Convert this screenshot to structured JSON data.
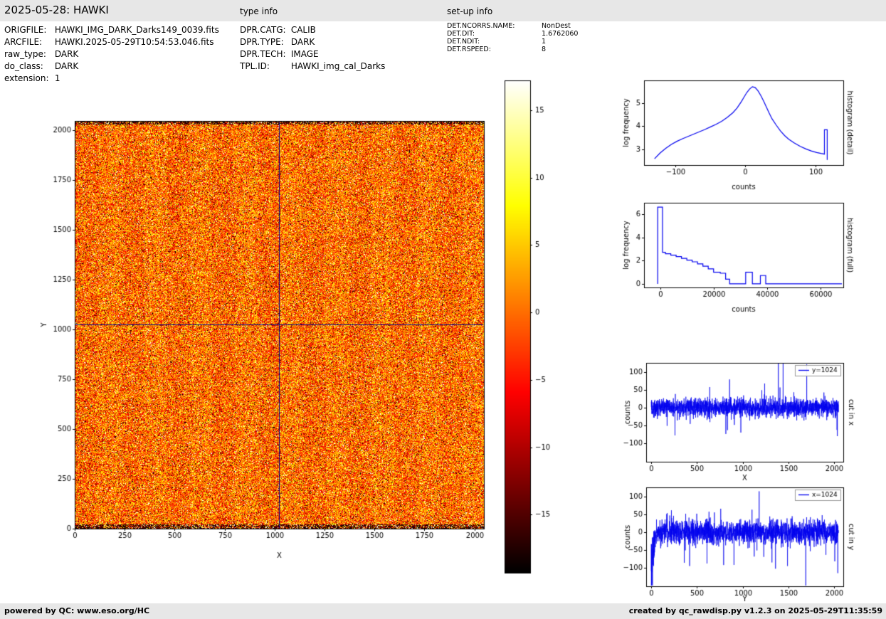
{
  "header": {
    "title": "2025-05-28: HAWKI",
    "type_info_label": "type info",
    "setup_info_label": "set-up info"
  },
  "file_info": {
    "rows": [
      {
        "label": "ORIGFILE:",
        "value": "HAWKI_IMG_DARK_Darks149_0039.fits"
      },
      {
        "label": "ARCFILE:",
        "value": "HAWKI.2025-05-29T10:54:53.046.fits"
      },
      {
        "label": "raw_type:",
        "value": "DARK"
      },
      {
        "label": "do_class:",
        "value": "DARK"
      },
      {
        "label": "extension:",
        "value": "1"
      }
    ]
  },
  "type_info": {
    "rows": [
      {
        "label": "DPR.CATG:",
        "value": "CALIB"
      },
      {
        "label": "DPR.TYPE:",
        "value": "DARK"
      },
      {
        "label": "DPR.TECH:",
        "value": "IMAGE"
      },
      {
        "label": "TPL.ID:",
        "value": "HAWKI_img_cal_Darks"
      }
    ]
  },
  "setup_info": {
    "rows": [
      {
        "label": "DET.NCORRS.NAME:",
        "value": "NonDest"
      },
      {
        "label": "DET.DIT:",
        "value": "1.6762060"
      },
      {
        "label": "DET.NDIT:",
        "value": "1"
      },
      {
        "label": "DET.RSPEED:",
        "value": "8"
      }
    ]
  },
  "footer": {
    "left": "powered by QC: www.eso.org/HC",
    "right": "created by qc_rawdisp.py v1.2.3 on 2025-05-29T11:35:59"
  },
  "colors": {
    "line_blue": "#0000ee",
    "crosshair_navy": "#00008b",
    "panel_gray": "#e7e7e7"
  },
  "chart_data": [
    {
      "id": "main-image",
      "type": "heatmap",
      "xlabel": "X",
      "ylabel": "Y",
      "xlim": [
        0,
        2048
      ],
      "ylim": [
        0,
        2048
      ],
      "xticks": [
        0,
        250,
        500,
        750,
        1000,
        1250,
        1500,
        1750,
        2000
      ],
      "yticks": [
        0,
        250,
        500,
        750,
        1000,
        1250,
        1500,
        1750,
        2000
      ],
      "colormap": "hot",
      "value_range": [
        -19.3,
        17.2
      ],
      "colorbar_ticks": [
        15,
        10,
        5,
        0,
        -5,
        -10,
        -15
      ],
      "crosshair_x": 1024,
      "crosshair_y": 1024,
      "description": "raw HAWKI dark frame: random noise centered on 0 counts with hot/cold pixel speckle, darker rows along top and bottom edges, navy crosshair lines at x=1024 and y=1024"
    },
    {
      "id": "histogram-detail",
      "type": "line",
      "side_label": "histogram (detail)",
      "xlabel": "counts",
      "ylabel": "log frequency",
      "xlim": [
        -145,
        140
      ],
      "ylim": [
        2.33,
        5.97
      ],
      "xticks": [
        -100,
        0,
        100
      ],
      "yticks": [
        3,
        4,
        5
      ],
      "x": [
        -130,
        -122,
        -114,
        -106,
        -98,
        -90,
        -82,
        -74,
        -66,
        -58,
        -50,
        -42,
        -34,
        -26,
        -18,
        -12,
        -6,
        -2,
        2,
        6,
        10,
        14,
        18,
        22,
        26,
        30,
        34,
        38,
        44,
        50,
        56,
        62,
        70,
        78,
        86,
        94,
        102,
        108,
        112,
        113,
        113,
        117,
        117
      ],
      "y": [
        2.6,
        2.85,
        3.05,
        3.22,
        3.35,
        3.46,
        3.56,
        3.66,
        3.76,
        3.86,
        3.97,
        4.08,
        4.21,
        4.38,
        4.58,
        4.78,
        5.05,
        5.25,
        5.45,
        5.6,
        5.7,
        5.66,
        5.52,
        5.32,
        5.08,
        4.82,
        4.56,
        4.32,
        4.05,
        3.8,
        3.6,
        3.44,
        3.28,
        3.14,
        3.03,
        2.94,
        2.87,
        2.83,
        2.81,
        2.8,
        3.85,
        3.85,
        2.55
      ]
    },
    {
      "id": "histogram-full",
      "type": "step",
      "side_label": "histogram (full)",
      "xlabel": "counts",
      "ylabel": "log frequency",
      "xlim": [
        -6000,
        68500
      ],
      "ylim": [
        -0.31,
        7.0
      ],
      "xticks": [
        0,
        20000,
        40000,
        60000
      ],
      "yticks": [
        0,
        2,
        4,
        6
      ],
      "bins": [
        [
          -900,
          900,
          6.62
        ],
        [
          900,
          2000,
          2.72
        ],
        [
          2000,
          4000,
          2.6
        ],
        [
          4000,
          6000,
          2.48
        ],
        [
          6000,
          8000,
          2.35
        ],
        [
          8000,
          10000,
          2.2
        ],
        [
          10000,
          12000,
          2.05
        ],
        [
          12000,
          14000,
          1.9
        ],
        [
          14000,
          16000,
          1.72
        ],
        [
          16000,
          18000,
          1.52
        ],
        [
          18000,
          20000,
          1.3
        ],
        [
          20000,
          22500,
          1.0
        ],
        [
          22500,
          24500,
          0.92
        ],
        [
          24500,
          26000,
          0.4
        ],
        [
          26000,
          32000,
          0
        ],
        [
          32000,
          34500,
          1.0
        ],
        [
          34500,
          37500,
          0
        ],
        [
          37500,
          39500,
          0.72
        ],
        [
          39500,
          68000,
          0
        ]
      ]
    },
    {
      "id": "cut-in-x",
      "type": "line",
      "legend": "y=1024",
      "side_label": "cut in x",
      "xlabel": "X",
      "ylabel": "counts",
      "xlim": [
        -55,
        2100
      ],
      "ylim": [
        -152,
        126
      ],
      "xticks": [
        0,
        500,
        1000,
        1500,
        2000
      ],
      "yticks": [
        -100,
        -50,
        0,
        50,
        100
      ],
      "n_points": 2048,
      "seed": 77,
      "noise_sd": 13,
      "spike_prob": 0.006,
      "spike_neg_prob": 0.5,
      "spikes": [
        [
          1390,
          140
        ],
        [
          1442,
          128
        ],
        [
          1700,
          122
        ],
        [
          1240,
          68
        ],
        [
          640,
          58
        ],
        [
          260,
          -78
        ],
        [
          980,
          -70
        ],
        [
          2035,
          -80
        ]
      ],
      "description": "row cut at y=1024: noise around 0 counts, tall clipped positive spikes near X=1400 and X=1700"
    },
    {
      "id": "cut-in-y",
      "type": "line",
      "legend": "x=1024",
      "side_label": "cut in y",
      "xlabel": "Y",
      "ylabel": "counts",
      "xlim": [
        -55,
        2100
      ],
      "ylim": [
        -152,
        126
      ],
      "xticks": [
        0,
        500,
        1000,
        1500,
        2000
      ],
      "yticks": [
        -100,
        -50,
        0,
        50,
        100
      ],
      "n_points": 2048,
      "seed": 913,
      "noise_sd": 16,
      "spike_prob": 0.014,
      "spike_neg_prob": 0.8,
      "start_dip": true,
      "spikes": [
        [
          1180,
          115
        ],
        [
          1690,
          -150
        ],
        [
          420,
          -95
        ],
        [
          610,
          -88
        ],
        [
          905,
          -92
        ],
        [
          1320,
          -85
        ],
        [
          1490,
          -95
        ],
        [
          2040,
          -115
        ],
        [
          760,
          66
        ]
      ],
      "description": "column cut at x=1024: noisier than x-cut, strong negative excursions near Y=0 and deep negative spikes; positive spike at Y=1180"
    }
  ]
}
